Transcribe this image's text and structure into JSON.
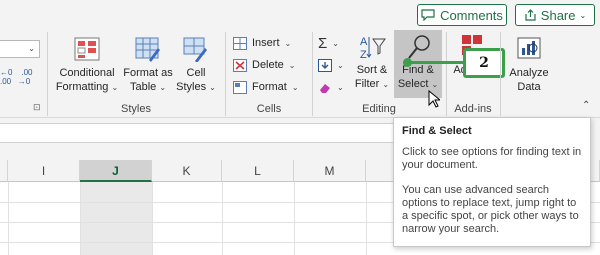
{
  "header": {
    "comments_label": "Comments",
    "share_label": "Share"
  },
  "number_group": {
    "dialog_launcher": "⊡"
  },
  "styles_group": {
    "conditional_l1": "Conditional",
    "conditional_l2": "Formatting",
    "format_table_l1": "Format as",
    "format_table_l2": "Table",
    "cell_styles_l1": "Cell",
    "cell_styles_l2": "Styles",
    "label": "Styles"
  },
  "cells_group": {
    "insert": "Insert",
    "delete": "Delete",
    "format": "Format",
    "label": "Cells"
  },
  "editing_group": {
    "sort_l1": "Sort &",
    "sort_l2": "Filter",
    "find_l1": "Find &",
    "find_l2": "Select",
    "label": "Editing"
  },
  "addins_group": {
    "addins_l1": "Add-ins",
    "label": "Add-ins",
    "badge_text": "2"
  },
  "analyze_group": {
    "l1": "Analyze",
    "l2": "Data"
  },
  "columns": [
    "I",
    "J",
    "K",
    "L",
    "M"
  ],
  "tooltip": {
    "title": "Find & Select",
    "p1": "Click to see options for finding text in your document.",
    "p2": "You can use advanced search options to replace text, jump right to a specific spot, or pick other ways to narrow your search."
  },
  "colors": {
    "accent_green": "#217346",
    "badge_border": "#3c9f4c",
    "highlight": "#c5c5c5"
  },
  "icons": [
    "comment-icon",
    "share-icon",
    "conditional-formatting-icon",
    "format-as-table-icon",
    "cell-styles-icon",
    "insert-icon",
    "delete-icon",
    "format-icon",
    "autosum-icon",
    "fill-icon",
    "clear-icon",
    "sort-filter-icon",
    "find-select-icon",
    "addins-icon",
    "analyze-data-icon",
    "mouse-cursor-icon"
  ]
}
